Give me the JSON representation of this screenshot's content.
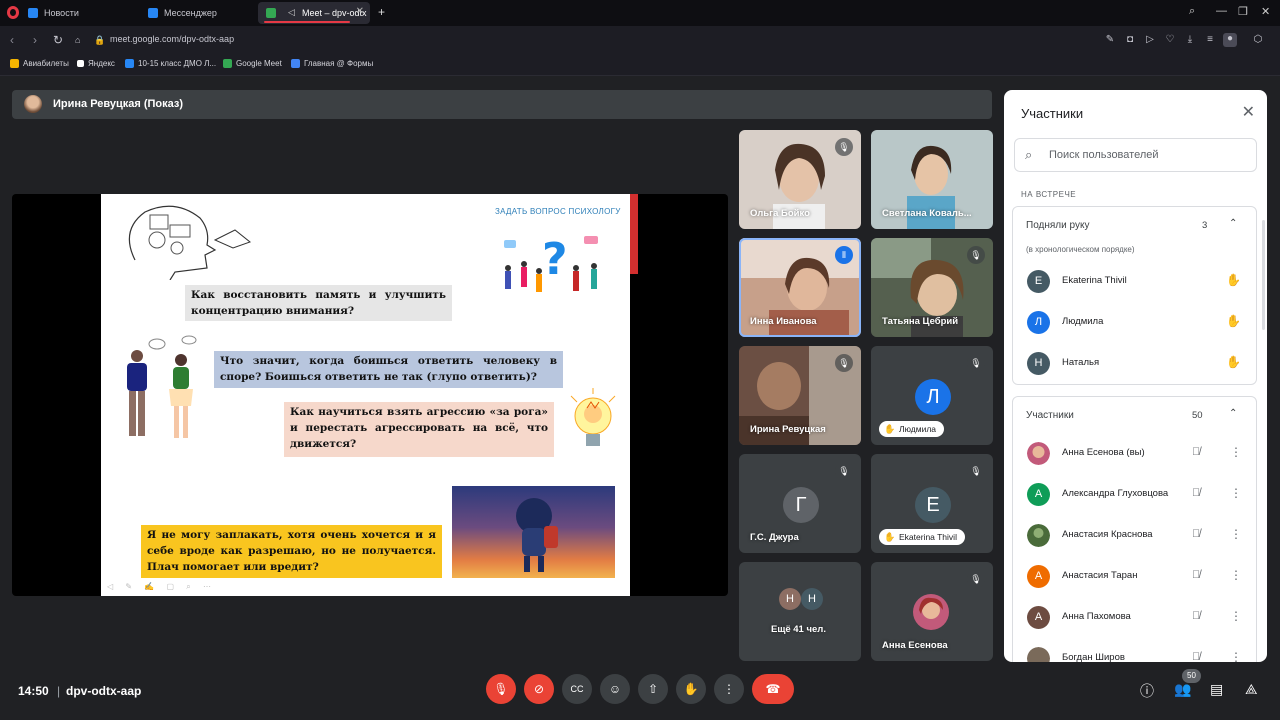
{
  "browser": {
    "tabs": [
      {
        "label": "Новости",
        "color": "#2787f5"
      },
      {
        "label": "Мессенджер",
        "color": "#2787f5"
      },
      {
        "label": "Meet – dpv-odtx",
        "color": "#34a853"
      }
    ],
    "url": "meet.google.com/dpv-odtx-aap",
    "bookmarks": [
      {
        "label": "Авиабилеты",
        "color": "#f4b400"
      },
      {
        "label": "Яндекс",
        "color": "#ffffff"
      },
      {
        "label": "10-15 класс ДМО Л...",
        "color": "#2787f5"
      },
      {
        "label": "Google Meet",
        "color": "#34a853"
      },
      {
        "label": "Главная @ Формы",
        "color": "#4285f4"
      }
    ]
  },
  "presenter": {
    "name": "Ирина Ревуцкая (Показ)"
  },
  "slide": {
    "header": "ЗАДАТЬ ВОПРОС ПСИХОЛОГУ",
    "q1": "Как восстановить память и улучшить концентрацию внимания?",
    "q2": "Что значит, когда боишься ответить человеку в споре? Боишься ответить не так (глупо ответить)?",
    "q3": "Как научиться взять агрессию «за рога» и перестать агрессировать на всё, что движется?",
    "q4": "Я не могу заплакать, хотя очень хочется и я себе вроде как разрешаю, но не получается. Плач помогает или вредит?"
  },
  "tiles": [
    {
      "name": "Ольга Бойко",
      "bg": "#c9c1bb"
    },
    {
      "name": "Светлана Коваль...",
      "bg": "#a8b4b8"
    },
    {
      "name": "Инна Иванова",
      "bg": "#b8906e"
    },
    {
      "name": "Татьяна Цебрий",
      "bg": "#6f7b6a"
    },
    {
      "name": "Ирина Ревуцкая",
      "bg": "#7a5a4a"
    },
    {
      "name": "Людмила",
      "initial": "Л",
      "color": "#1a73e8"
    },
    {
      "name": "Г.С. Джура",
      "initial": "Г",
      "color": "#5f6368"
    },
    {
      "name": "Ekaterina Thivil",
      "initial": "E",
      "color": "#455a64"
    },
    {
      "name": "Ещё 41 чел.",
      "initial_a": "Н",
      "initial_b": "Н"
    },
    {
      "name": "Анна Есенова"
    }
  ],
  "panel": {
    "title": "Участники",
    "search_placeholder": "Поиск пользователей",
    "section_label": "НА ВСТРЕЧЕ",
    "raised": {
      "title": "Подняли руку",
      "count": "3",
      "subtitle": "(в хронологическом порядке)",
      "people": [
        {
          "initial": "E",
          "name": "Ekaterina Thivil",
          "color": "#455a64"
        },
        {
          "initial": "Л",
          "name": "Людмила",
          "color": "#1a73e8"
        },
        {
          "initial": "Н",
          "name": "Наталья",
          "color": "#455a64"
        }
      ]
    },
    "participants": {
      "title": "Участники",
      "count": "50",
      "people": [
        {
          "initial": "",
          "name": "Анна Есенова (вы)",
          "color": "#c25a7a"
        },
        {
          "initial": "А",
          "name": "Александра Глуховцова",
          "color": "#0f9d58"
        },
        {
          "initial": "",
          "name": "Анастасия Краснова",
          "color": "#4a6b3a"
        },
        {
          "initial": "А",
          "name": "Анастасия Таран",
          "color": "#ef6c00"
        },
        {
          "initial": "А",
          "name": "Анна Пахомова",
          "color": "#6d4c41"
        },
        {
          "initial": "",
          "name": "Богдан Широв",
          "color": "#7a6a5a"
        }
      ]
    }
  },
  "bottom": {
    "time": "14:50",
    "meeting_code": "dpv-odtx-aap",
    "participants_badge": "50"
  }
}
